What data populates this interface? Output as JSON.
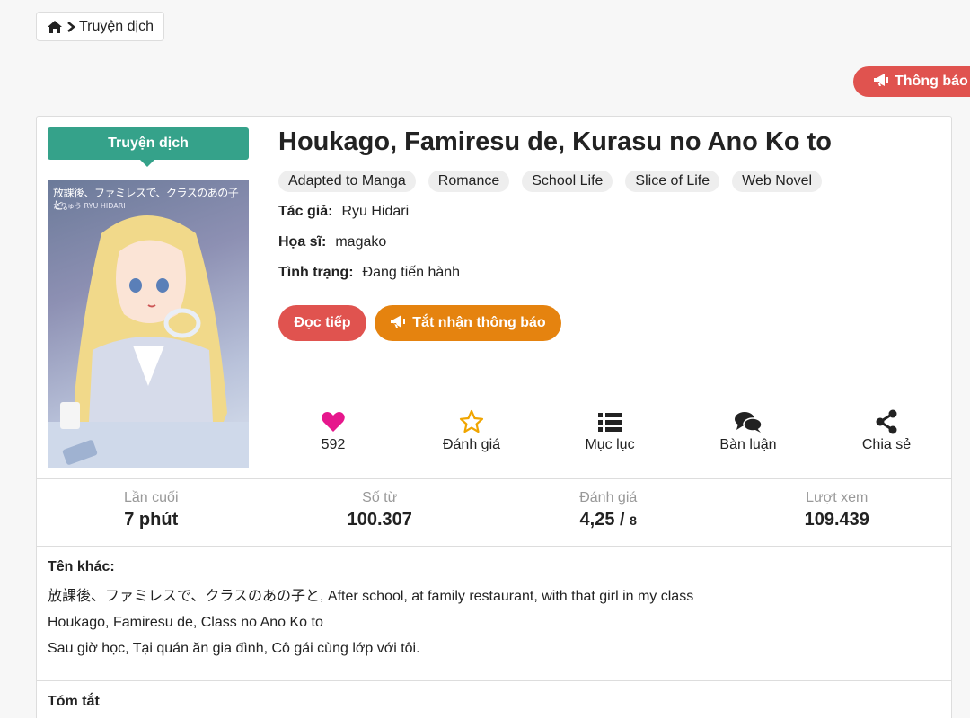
{
  "breadcrumb": {
    "home_icon": "home-icon",
    "separator_icon": "chevron-right-icon",
    "label": "Truyện dịch"
  },
  "floating_notice": {
    "icon": "megaphone-icon",
    "label": "Thông báo"
  },
  "novel": {
    "type_badge": "Truyện dịch",
    "cover_title": "放課後、ファミレスで、クラスのあの子と。",
    "cover_byline": "たりゅう RYU HIDARI",
    "title": "Houkago, Famiresu de, Kurasu no Ano Ko to",
    "tags": [
      "Adapted to Manga",
      "Romance",
      "School Life",
      "Slice of Life",
      "Web Novel"
    ],
    "author_label": "Tác giả:",
    "author": "Ryu Hidari",
    "artist_label": "Họa sĩ:",
    "artist": "magako",
    "status_label": "Tình trạng:",
    "status": "Đang tiến hành"
  },
  "buttons": {
    "read_continue": "Đọc tiếp",
    "toggle_notify": "Tắt nhận thông báo"
  },
  "actions": {
    "like_count": "592",
    "rate": "Đánh giá",
    "toc": "Mục lục",
    "discuss": "Bàn luận",
    "share": "Chia sẻ"
  },
  "stats": {
    "last_update_label": "Lần cuối",
    "last_update_value": "7 phút",
    "word_count_label": "Số từ",
    "word_count_value": "100.307",
    "rating_label": "Đánh giá",
    "rating_value": "4,25 / ",
    "rating_count": "8",
    "views_label": "Lượt xem",
    "views_value": "109.439"
  },
  "alt_names": {
    "heading": "Tên khác:",
    "lines": [
      "放課後、ファミレスで、クラスのあの子と, After school, at family restaurant, with that girl in my class",
      "Houkago, Famiresu de, Class no Ano Ko to",
      "Sau giờ học, Tại quán ăn gia đình, Cô gái cùng lớp với tôi."
    ]
  },
  "summary": {
    "heading": "Tóm tắt"
  },
  "colors": {
    "red": "#e0534f",
    "orange": "#e5830f",
    "teal": "#35a28a",
    "heart": "#e6178c",
    "star": "#f0a500"
  }
}
